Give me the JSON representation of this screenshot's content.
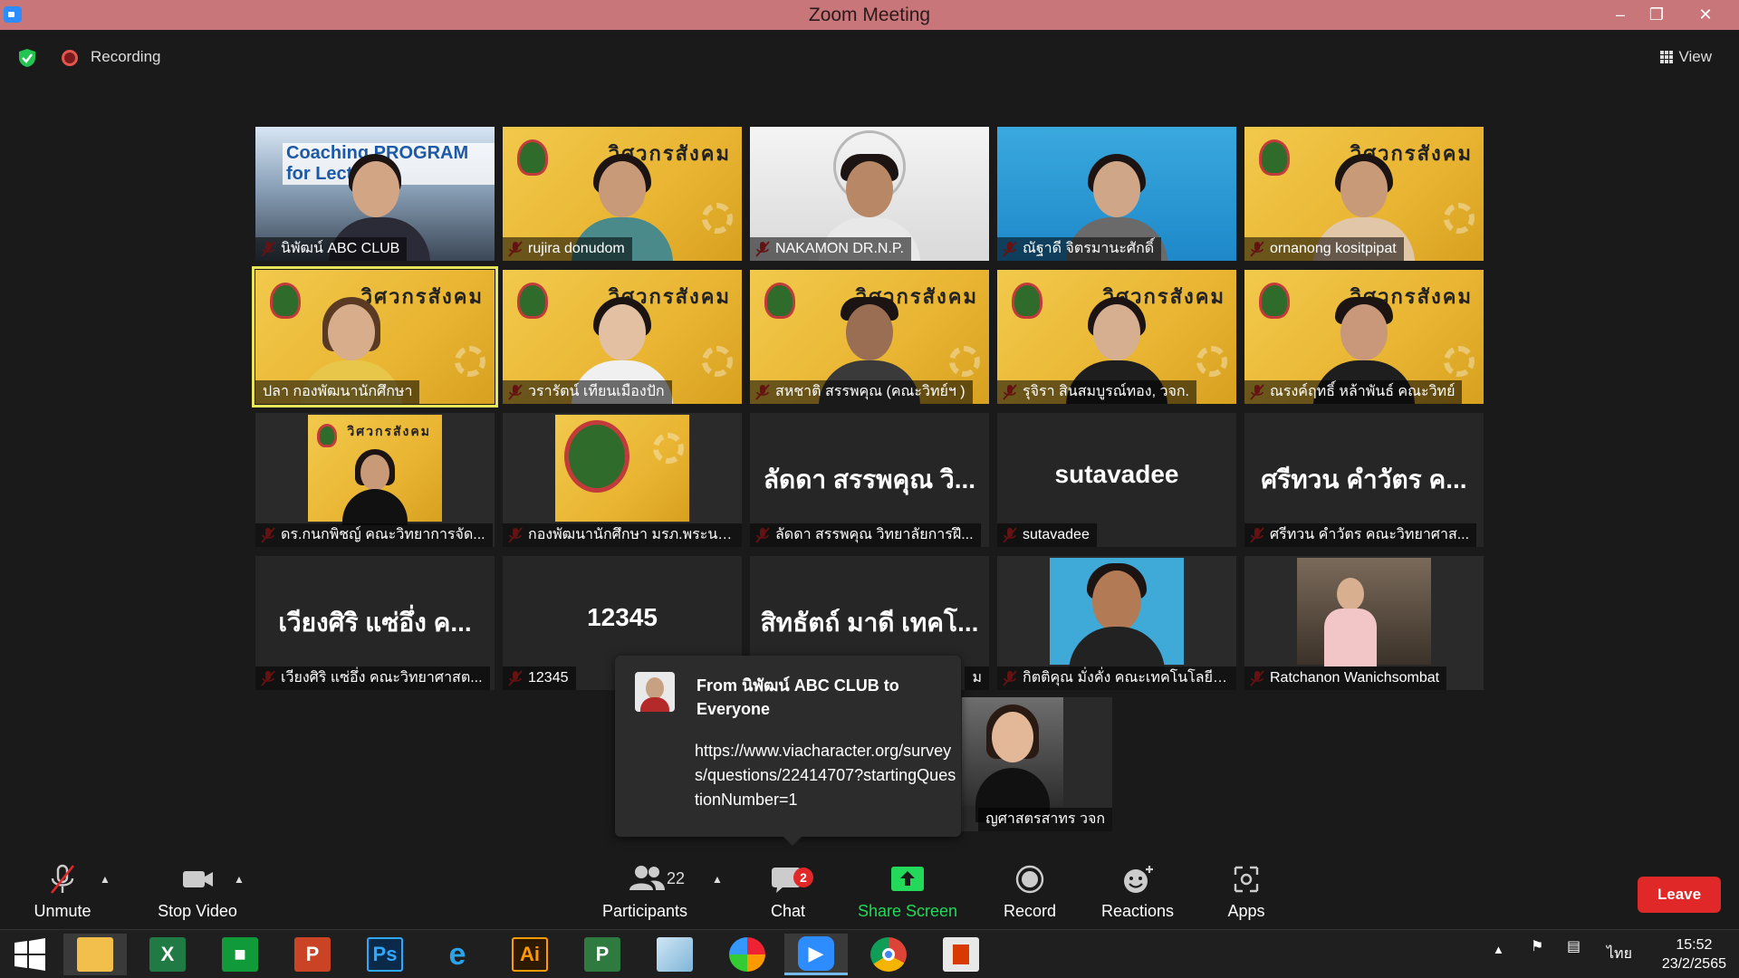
{
  "window": {
    "title": "Zoom Meeting"
  },
  "topbar": {
    "recording_label": "Recording",
    "view_label": "View"
  },
  "tiles": [
    {
      "name": "นิพัฒน์ ABC CLUB",
      "overlay_text": "Coaching PROGRAM for Lecturer"
    },
    {
      "name": "rujira donudom"
    },
    {
      "name": "NAKAMON DR.N.P."
    },
    {
      "name": "ณัฐาดี จิตรมานะศักดิ์"
    },
    {
      "name": "ornanong kositpipat"
    },
    {
      "name": "ปลา กองพัฒนานักศึกษา"
    },
    {
      "name": "วรารัตน์ เทียนเมืองปัก"
    },
    {
      "name": "สหชาติ สรรพคุณ (คณะวิทย์ฯ )"
    },
    {
      "name": "รุจิรา สินสมบูรณ์ทอง, วจก."
    },
    {
      "name": "ณรงค์ฤทธิ์ หล้าพันธ์ คณะวิทย์"
    },
    {
      "name": "ดร.กนกพิชญ์ คณะวิทยาการจัด..."
    },
    {
      "name": "กองพัฒนานักศึกษา มรภ.พระนคร"
    },
    {
      "big": "ลัดดา สรรพคุณ วิ...",
      "name": "ลัดดา สรรพคุณ วิทยาลัยการฝึ..."
    },
    {
      "big": "sutavadee",
      "name": "sutavadee"
    },
    {
      "big": "ศรีทวน คำวัตร ค...",
      "name": "ศรีทวน คำวัตร คณะวิทยาศาส..."
    },
    {
      "big": "เวียงศิริ แซ่อึ่ง ค...",
      "name": "เวียงศิริ แซ่อึ่ง คณะวิทยาศาสต..."
    },
    {
      "big": "12345",
      "name": "12345"
    },
    {
      "big": "สิทธัตถ์ มาดี เทคโ...",
      "name": "ม"
    },
    {
      "name": "กิตติคุณ มั่งคั่ง คณะเทคโนโลยีอุ..."
    },
    {
      "name": "Ratchanon Wanichsombat"
    },
    {
      "name": "ญศาสตรสาทร วจก"
    }
  ],
  "banner_text": "วิศวกรสังคม",
  "chat_popup": {
    "from": "From นิพัฒน์ ABC CLUB to Everyone",
    "message": "https://www.viacharacter.org/surveys/questions/22414707?startingQuestionNumber=1"
  },
  "toolbar": {
    "unmute": "Unmute",
    "stop_video": "Stop Video",
    "participants": "Participants",
    "participants_count": "22",
    "chat": "Chat",
    "chat_badge": "2",
    "share_screen": "Share Screen",
    "record": "Record",
    "reactions": "Reactions",
    "apps": "Apps",
    "leave": "Leave"
  },
  "taskbar": {
    "apps": [
      "file-explorer",
      "excel",
      "store",
      "powerpoint",
      "photoshop",
      "internet-explorer",
      "illustrator",
      "project",
      "notepad",
      "photoscape",
      "zoom",
      "chrome",
      "office"
    ],
    "language": "ไทย",
    "time": "15:52",
    "date": "23/2/2565"
  },
  "colors": {
    "leave": "#e02828",
    "share_screen": "#23d959",
    "titlebar": "#c9767a",
    "active_speaker": "#e8e55a"
  }
}
